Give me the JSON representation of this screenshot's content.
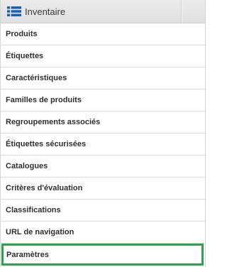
{
  "header": {
    "title": "Inventaire",
    "icon": "list-icon",
    "icon_color": "#1a5fb4"
  },
  "items": [
    {
      "label": "Produits"
    },
    {
      "label": "Étiquettes"
    },
    {
      "label": "Caractéristiques"
    },
    {
      "label": "Familles de produits"
    },
    {
      "label": "Regroupements associés"
    },
    {
      "label": "Étiquettes sécurisées"
    },
    {
      "label": "Catalogues"
    },
    {
      "label": "Critères d'évaluation"
    },
    {
      "label": "Classifications"
    },
    {
      "label": "URL de navigation"
    },
    {
      "label": "Paramètres",
      "selected": true
    }
  ],
  "colors": {
    "highlight": "#2aa34a"
  }
}
